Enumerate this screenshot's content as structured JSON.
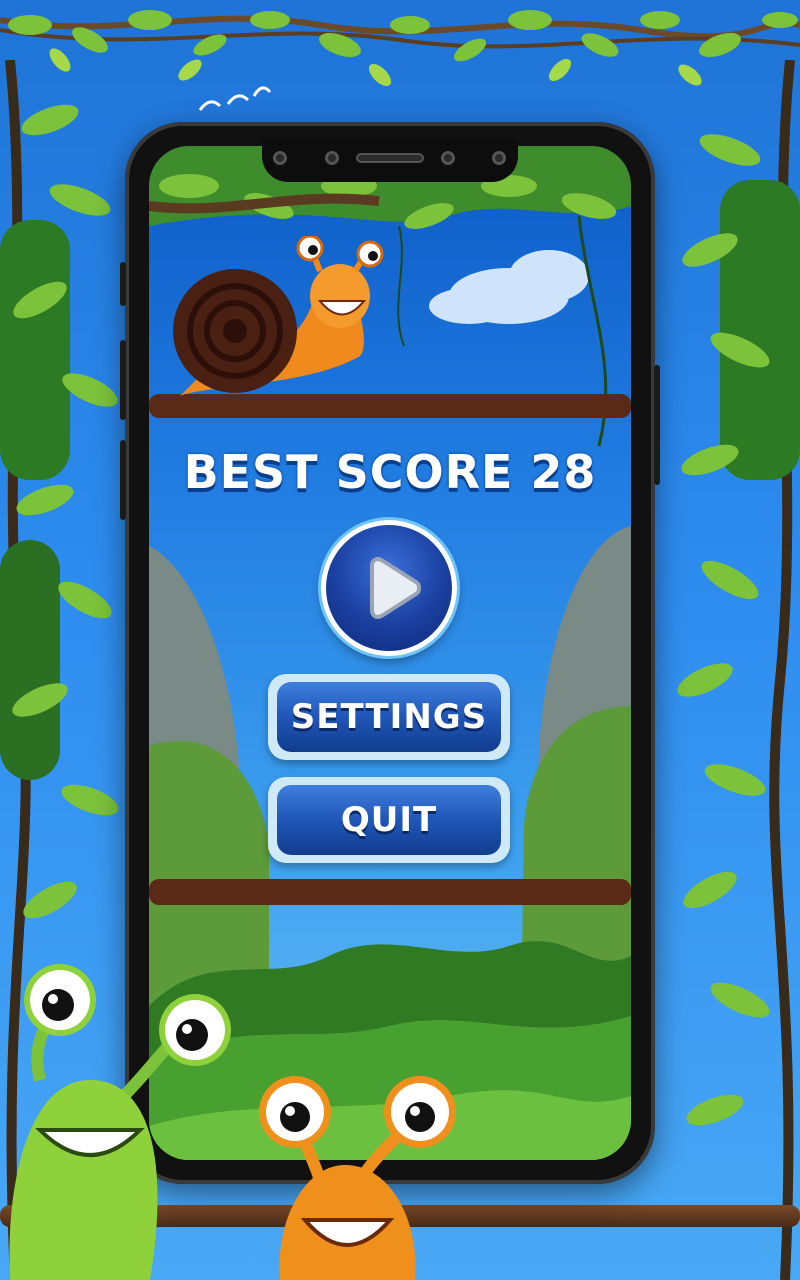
{
  "game": {
    "best_score_label": "BEST SCORE 28",
    "buttons": {
      "play": "play",
      "settings": "SETTINGS",
      "quit": "QUIT"
    }
  },
  "icons": [
    "play-icon",
    "snail",
    "green-slug",
    "orange-slug",
    "camera-icon",
    "speaker-icon"
  ],
  "colors": {
    "sky_top": "#1f73d6",
    "button_blue": "#1f56b8",
    "button_border": "#cfe9f7",
    "snail_shell": "#5a2a18",
    "snail_body": "#f08a1c",
    "green_slug": "#8fd13a",
    "orange_slug": "#f0901c"
  }
}
